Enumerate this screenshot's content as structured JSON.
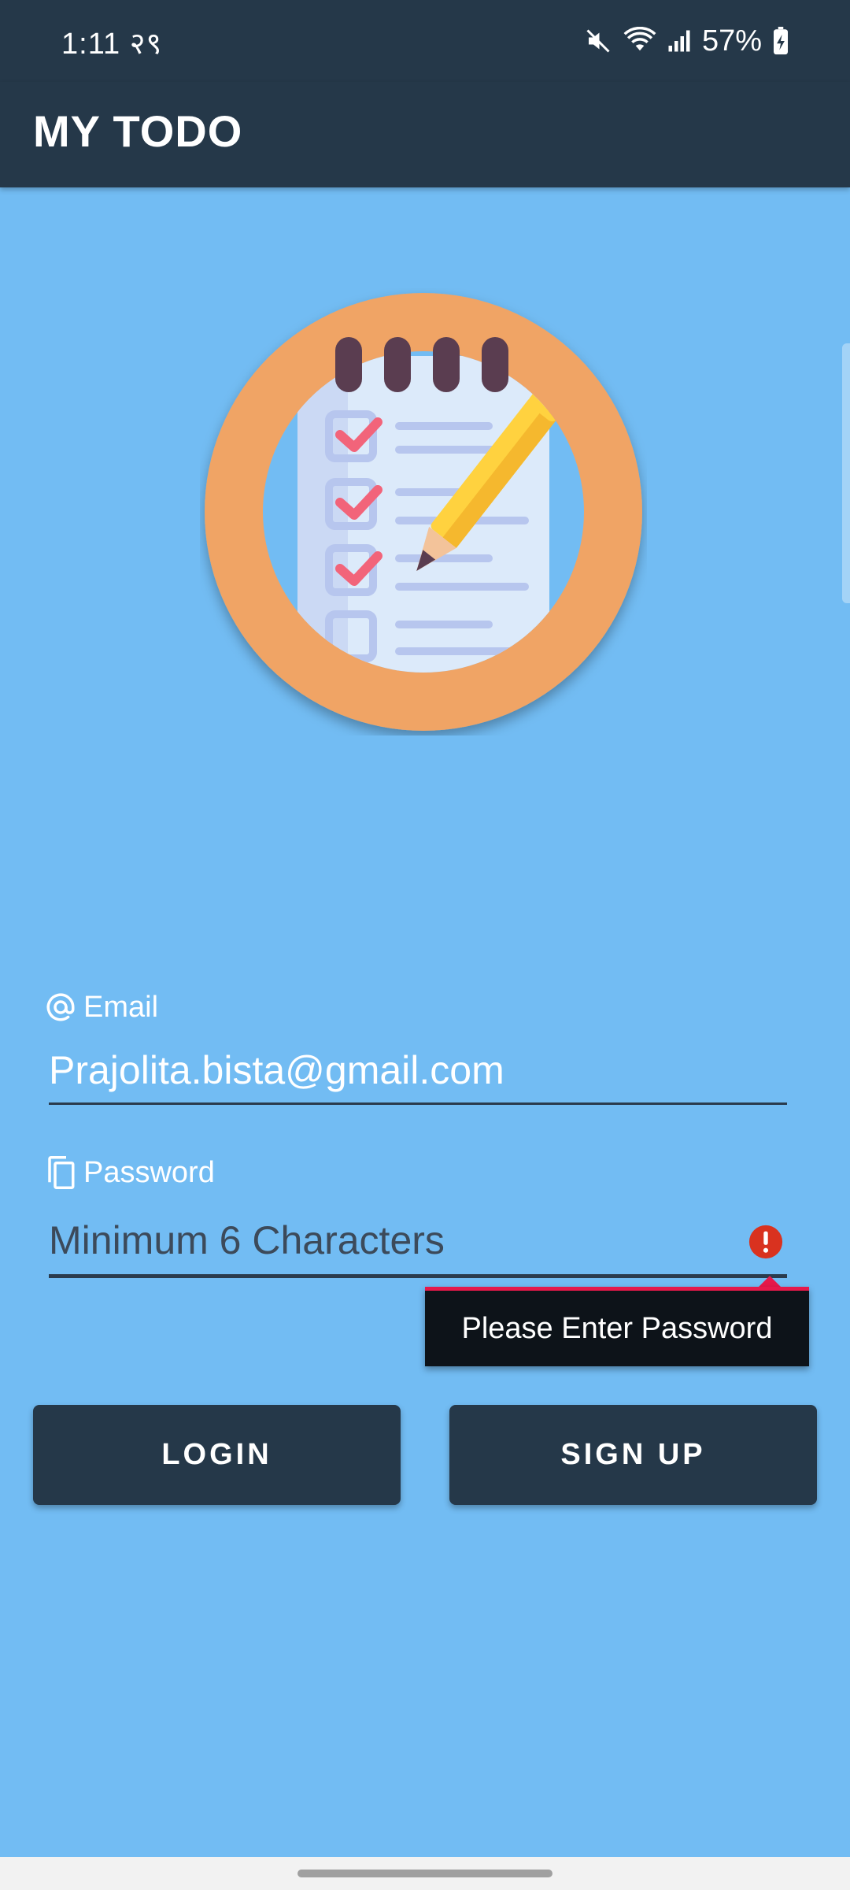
{
  "status_bar": {
    "time": "1:11",
    "time_extra": "२९",
    "battery": "57%"
  },
  "app_bar": {
    "title": "MY TODO"
  },
  "logo": {
    "icon": "todo-notepad-icon"
  },
  "form": {
    "email": {
      "label": "Email",
      "icon": "at-icon",
      "value": "Prajolita.bista@gmail.com"
    },
    "password": {
      "label": "Password",
      "icon": "copy-icon",
      "placeholder": "Minimum 6 Characters",
      "error": "Please Enter Password"
    }
  },
  "buttons": {
    "login": "LOGIN",
    "signup": "SIGN UP"
  },
  "colors": {
    "primary": "#253849",
    "background": "#72bcf3",
    "logo_ring": "#f0a465",
    "error": "#e6194b"
  }
}
